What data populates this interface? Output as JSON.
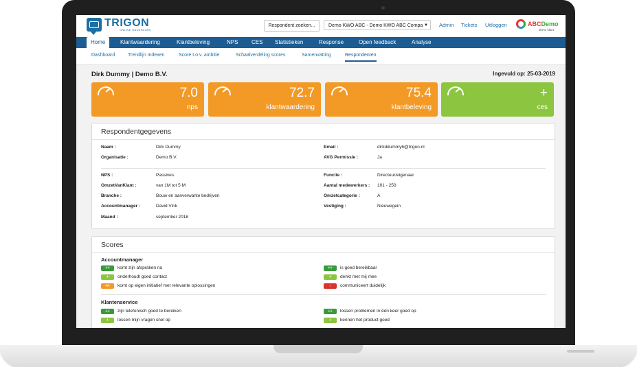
{
  "header": {
    "logo_text": "TRIGON",
    "logo_subtext": "ONLINE ONDERZOEK",
    "search_button": "Respondent zoeken...",
    "company_select": "Demo KWO ABC - Demo KWO ABC Compa",
    "links": [
      "Admin",
      "Tickets",
      "Uitloggen"
    ],
    "client_logo_text_1": "ABC",
    "client_logo_text_2": "Demo",
    "client_logo_sub": "demo klant"
  },
  "nav": {
    "items": [
      "Home",
      "Klantwaardering",
      "Klantbeleving",
      "NPS",
      "CES",
      "Statistieken",
      "Response",
      "Open feedback",
      "Analyse"
    ]
  },
  "subnav": {
    "items": [
      "Dashboard",
      "Trendlijn Indexen",
      "Score t.o.v. ambitie",
      "Schaalverdeling scores",
      "Samenvatting",
      "Respondenten"
    ]
  },
  "page": {
    "title": "Dirk Dummy | Demo B.V.",
    "filled_date": "Ingevuld op: 25-03-2019"
  },
  "tiles": [
    {
      "value": "7.0",
      "label": "nps",
      "color": "#f39a26"
    },
    {
      "value": "72.7",
      "label": "klantwaardering",
      "color": "#f39a26"
    },
    {
      "value": "75.4",
      "label": "klantbeleving",
      "color": "#f39a26"
    },
    {
      "value": "+",
      "label": "ces",
      "color": "#8cc540"
    }
  ],
  "respondent": {
    "title": "Respondentgegevens",
    "left_top": [
      {
        "label": "Naam :",
        "value": "Dirk Dummy"
      },
      {
        "label": "Organisatie :",
        "value": "Demo B.V."
      }
    ],
    "right_top": [
      {
        "label": "Email :",
        "value": "dirkddummy6@trigon.nl"
      },
      {
        "label": "AVG Permissie :",
        "value": "Ja"
      }
    ],
    "left_bottom": [
      {
        "label": "NPS :",
        "value": "Passives"
      },
      {
        "label": "OmzetVanKlant :",
        "value": "van 1M tot 5 M"
      },
      {
        "label": "Branche :",
        "value": "Bouw en aanverwante bedrijven"
      },
      {
        "label": "Accountmanager :",
        "value": "David Vink"
      },
      {
        "label": "Maand :",
        "value": "september 2018"
      }
    ],
    "right_bottom": [
      {
        "label": "Functie :",
        "value": "Directeur/eigenaar"
      },
      {
        "label": "Aantal medewerkers :",
        "value": "101 - 250"
      },
      {
        "label": "Omzetcategorie :",
        "value": "A"
      },
      {
        "label": "Vestiging :",
        "value": "Nieuwegein"
      }
    ]
  },
  "scores": {
    "title": "Scores",
    "colors": {
      "very_positive": "#3a9a3a",
      "positive": "#8cc540",
      "neutral": "#f39a26",
      "negative": "#d9342b"
    },
    "groups": [
      {
        "title": "Accountmanager",
        "left": [
          {
            "badge": "++",
            "level": "very_positive",
            "text": "komt zijn afspraken na"
          },
          {
            "badge": "+",
            "level": "positive",
            "text": "onderhoudt goed contact"
          },
          {
            "badge": "+/-",
            "level": "neutral",
            "text": "komt op eigen initiatief met relevante oplossingen"
          }
        ],
        "right": [
          {
            "badge": "++",
            "level": "very_positive",
            "text": "is goed bereikbaar"
          },
          {
            "badge": "+",
            "level": "positive",
            "text": "denkt met mij mee"
          },
          {
            "badge": "-",
            "level": "negative",
            "text": "communiceert duidelijk"
          }
        ]
      },
      {
        "title": "Klantenservice",
        "left": [
          {
            "badge": "++",
            "level": "very_positive",
            "text": "zijn telefonisch goed te bereiken"
          },
          {
            "badge": "+",
            "level": "positive",
            "text": "lossen mijn vragen snel op"
          }
        ],
        "right": [
          {
            "badge": "++",
            "level": "very_positive",
            "text": "lossen problemen in één keer goed op"
          },
          {
            "badge": "+",
            "level": "positive",
            "text": "kennen het product goed"
          }
        ]
      }
    ]
  }
}
